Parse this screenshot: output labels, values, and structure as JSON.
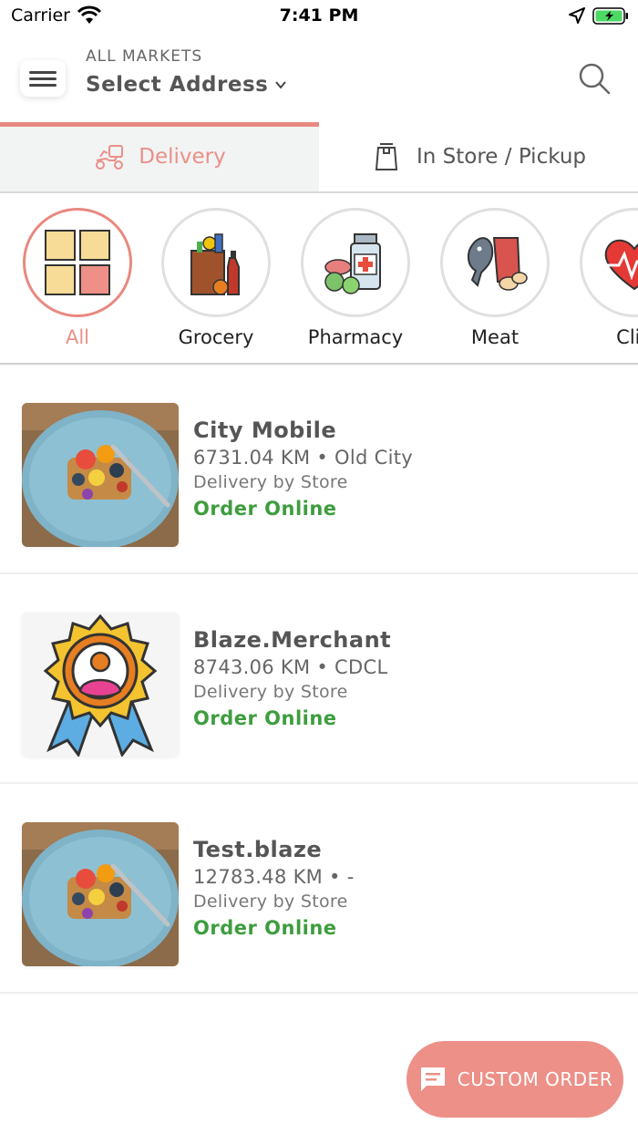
{
  "status_bar": {
    "carrier": "Carrier",
    "time": "7:41 PM"
  },
  "header": {
    "market_label": "ALL MARKETS",
    "address_label": "Select Address"
  },
  "tabs": [
    {
      "label": "Delivery",
      "icon": "scooter-icon",
      "active": true
    },
    {
      "label": "In Store / Pickup",
      "icon": "bag-icon",
      "active": false
    }
  ],
  "categories": [
    {
      "label": "All",
      "icon": "grid-icon",
      "selected": true
    },
    {
      "label": "Grocery",
      "icon": "grocery-bag-icon",
      "selected": false
    },
    {
      "label": "Pharmacy",
      "icon": "pharmacy-icon",
      "selected": false
    },
    {
      "label": "Meat",
      "icon": "meat-icon",
      "selected": false
    },
    {
      "label": "Clin",
      "icon": "heart-pulse-icon",
      "selected": false
    }
  ],
  "stores": [
    {
      "name": "City Mobile",
      "meta": "6731.04 KM • Old City",
      "delivery": "Delivery by Store",
      "cta": "Order Online",
      "image": "food-plate"
    },
    {
      "name": "Blaze.Merchant",
      "meta": "8743.06 KM • CDCL",
      "delivery": "Delivery by Store",
      "cta": "Order Online",
      "image": "badge"
    },
    {
      "name": "Test.blaze",
      "meta": "12783.48 KM • -",
      "delivery": "Delivery by Store",
      "cta": "Order Online",
      "image": "food-plate"
    }
  ],
  "fab": {
    "label": "CUSTOM ORDER"
  },
  "colors": {
    "accent": "#e8897f",
    "order_online": "#3e9d3e",
    "fab": "#ec9088"
  }
}
